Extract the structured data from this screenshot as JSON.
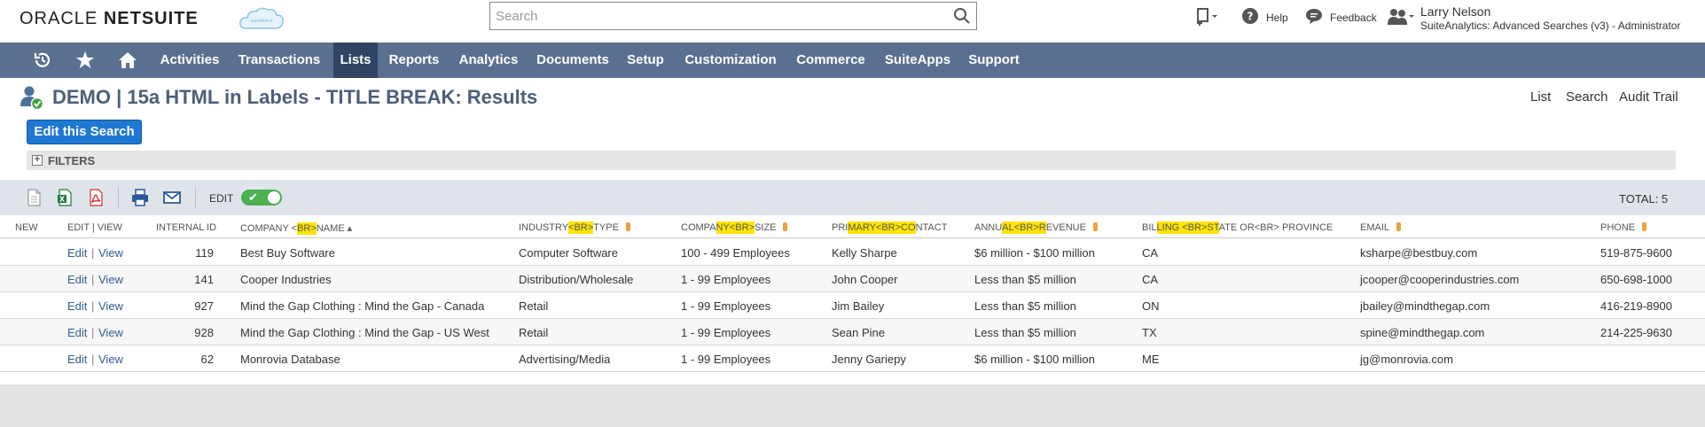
{
  "header": {
    "logo_prefix": "ORACLE",
    "logo_suffix": "NETSUITE",
    "search_placeholder": "Search",
    "help_label": "Help",
    "feedback_label": "Feedback",
    "user_name": "Larry Nelson",
    "user_role": "SuiteAnalytics: Advanced Searches (v3) - Administrator"
  },
  "nav": {
    "items": [
      "Activities",
      "Transactions",
      "Lists",
      "Reports",
      "Analytics",
      "Documents",
      "Setup",
      "Customization",
      "Commerce",
      "SuiteApps",
      "Support"
    ],
    "active": "Lists"
  },
  "page": {
    "title": "DEMO | 15a HTML in Labels - TITLE BREAK: Results",
    "links": [
      "List",
      "Search",
      "Audit Trail"
    ],
    "edit_button": "Edit this Search",
    "filters_label": "FILTERS",
    "edit_label": "EDIT",
    "total": "TOTAL: 5"
  },
  "table": {
    "headers": {
      "new": "NEW",
      "edit_view": "EDIT | VIEW",
      "internal_id": "INTERNAL ID",
      "company_a": "COMPANY <",
      "company_hl": "BR>",
      "company_b": "NAME ▴",
      "industry_a": "INDUSTRY",
      "industry_hl": "<BR>",
      "industry_b": "TYPE",
      "size_a": "COMPA",
      "size_hl": "NY<BR>",
      "size_b": "SIZE",
      "contact_a": "PRI",
      "contact_hl": "MARY<BR>CO",
      "contact_b": "NTACT",
      "revenue_a": "ANNU",
      "revenue_hl": "AL<BR>R",
      "revenue_b": "EVENUE",
      "state_a": "BIL",
      "state_hl": "LING <BR>ST",
      "state_b": "ATE OR<BR> PROVINCE",
      "email": "EMAIL",
      "phone": "PHONE"
    },
    "edit_link": "Edit",
    "view_link": "View",
    "rows": [
      {
        "id": "119",
        "company": "Best Buy Software",
        "industry": "Computer Software",
        "size": "100 - 499 Employees",
        "contact": "Kelly Sharpe",
        "revenue": "$6 million - $100 million",
        "state": "CA",
        "email": "ksharpe@bestbuy.com",
        "phone": "519-875-9600"
      },
      {
        "id": "141",
        "company": "Cooper Industries",
        "industry": "Distribution/Wholesale",
        "size": "1 - 99 Employees",
        "contact": "John Cooper",
        "revenue": "Less than $5 million",
        "state": "CA",
        "email": "jcooper@cooperindustries.com",
        "phone": "650-698-1000"
      },
      {
        "id": "927",
        "company": "Mind the Gap Clothing : Mind the Gap - Canada",
        "industry": "Retail",
        "size": "1 - 99 Employees",
        "contact": "Jim Bailey",
        "revenue": "Less than $5 million",
        "state": "ON",
        "email": "jbailey@mindthegap.com",
        "phone": "416-219-8900"
      },
      {
        "id": "928",
        "company": "Mind the Gap Clothing : Mind the Gap - US West",
        "industry": "Retail",
        "size": "1 - 99 Employees",
        "contact": "Sean Pine",
        "revenue": "Less than $5 million",
        "state": "TX",
        "email": "spine@mindthegap.com",
        "phone": "214-225-9630"
      },
      {
        "id": "62",
        "company": "Monrovia Database",
        "industry": "Advertising/Media",
        "size": "1 - 99 Employees",
        "contact": "Jenny Gariepy",
        "revenue": "$6 million - $100 million",
        "state": "ME",
        "email": "jg@monrovia.com",
        "phone": ""
      }
    ]
  },
  "colors": {
    "nav_bg": "#5a7090",
    "nav_active": "#2f4563",
    "title": "#4d5f79",
    "button": "#1f78d1",
    "highlight": "#ffe500",
    "toggle": "#4caf50"
  }
}
